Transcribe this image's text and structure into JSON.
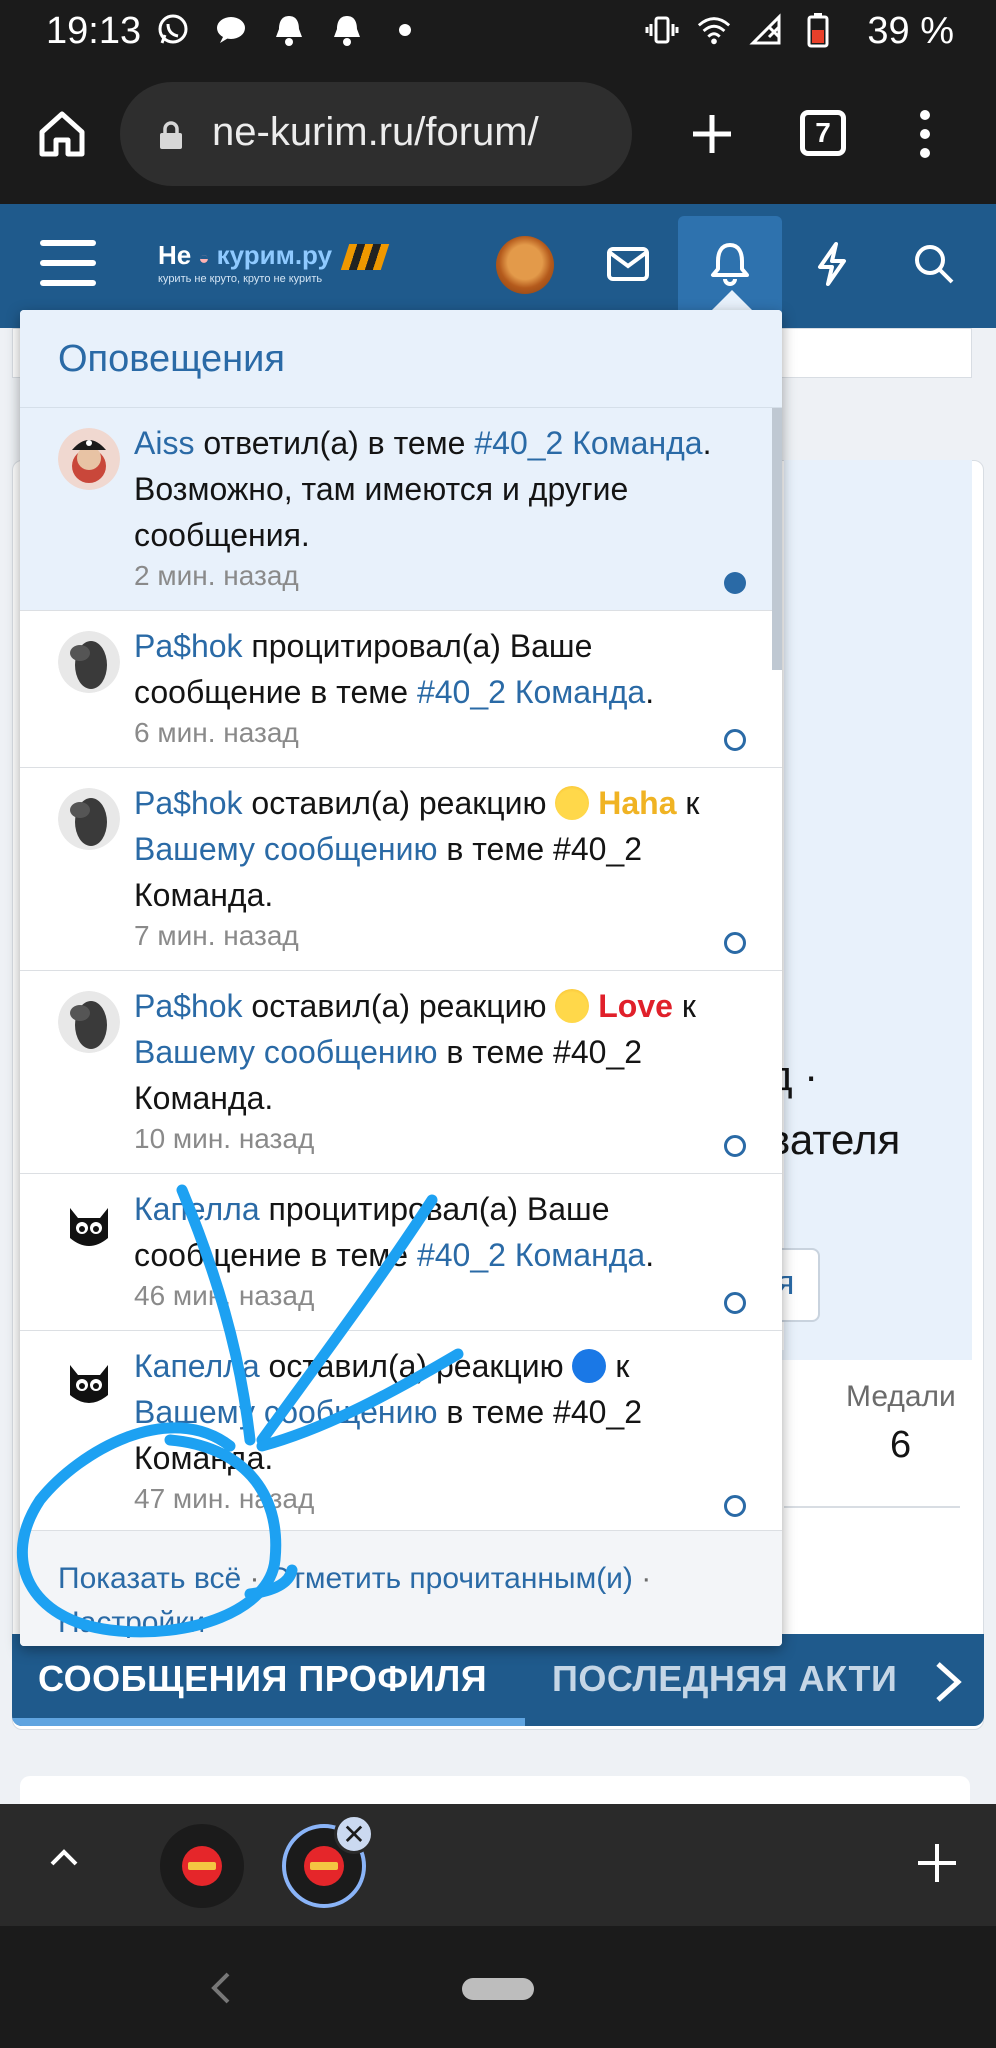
{
  "status_bar": {
    "time": "19:13",
    "battery": "39 %",
    "left_icons": [
      "whatsapp-icon",
      "message-icon",
      "bell-icon",
      "bell-icon",
      "dot-icon"
    ],
    "right_icons": [
      "vibrate-icon",
      "wifi-icon",
      "no-signal-icon",
      "battery-icon"
    ]
  },
  "browser": {
    "url": "ne-kurim.ru/forum/",
    "tab_count": "7"
  },
  "forum_header": {
    "logo_main_part1": "Не",
    "logo_main_part2": "курим.ру",
    "logo_tagline": "курить не круто, круто не курить"
  },
  "notifications": {
    "title": "Оповещения",
    "items": [
      {
        "user": "Aiss",
        "action": " ответил(а) в теме ",
        "link": "#40_2 Команда",
        "rest": ". Возможно, там имеются и другие сообщения.",
        "time": "2 мин. назад",
        "unread": true
      },
      {
        "user": "Pa$hok",
        "action": " процитировал(а) Ваше сообщение в теме ",
        "link": "#40_2 Команда",
        "rest": ".",
        "time": "6 мин. назад",
        "unread": false
      },
      {
        "user": "Pa$hok",
        "action": " оставил(а) реакцию ",
        "reaction": "Haha",
        "to": " к ",
        "link": "Вашему сообщению",
        "rest": " в теме #40_2 Команда.",
        "time": "7 мин. назад",
        "unread": false
      },
      {
        "user": "Pa$hok",
        "action": " оставил(а) реакцию ",
        "reaction": "Love",
        "to": " к ",
        "link": "Вашему сообщению",
        "rest": " в теме #40_2 Команда.",
        "time": "10 мин. назад",
        "unread": false
      },
      {
        "user": "Капелла",
        "action": " процитировал(а) Ваше сообщение в теме ",
        "link": "#40_2 Команда",
        "rest": ".",
        "time": "46 мин. назад",
        "unread": false
      },
      {
        "user": "Капелла",
        "action": " оставил(а) реакцию ",
        "to": " к ",
        "link": "Вашему сообщению",
        "rest": " в теме #40_2 Команда.",
        "time": "47 мин. назад",
        "unread": false
      }
    ],
    "footer": {
      "show_all": "Показать всё",
      "mark_read": "Отметить прочитанным(и)",
      "separator": "·",
      "settings": "Настройки"
    }
  },
  "background_page": {
    "fragment_1": "д ·",
    "fragment_2": "вателя",
    "fragment_3": "я",
    "medals_label": "Медали",
    "medals_value": "6",
    "tabs": [
      "СООБЩЕНИЯ ПРОФИЛЯ",
      "ПОСЛЕДНЯЯ АКТИ"
    ]
  },
  "colors": {
    "forum_blue": "#1f5a8c",
    "link_blue": "#2a6aa6",
    "scribble": "#1da1f2"
  }
}
